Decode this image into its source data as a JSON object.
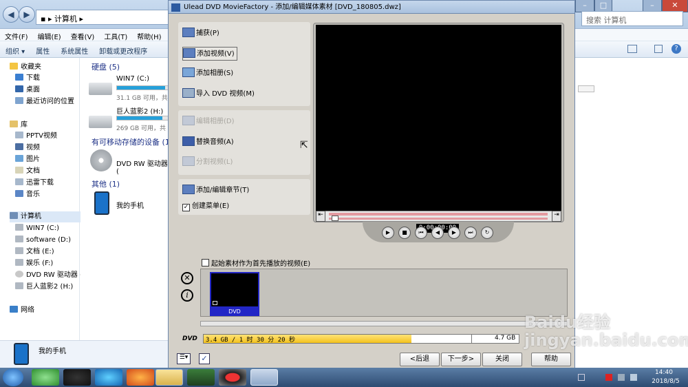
{
  "explorer": {
    "breadcrumb": "计算机",
    "search_placeholder": "搜索 计算机",
    "menu": [
      "文件(F)",
      "编辑(E)",
      "查看(V)",
      "工具(T)",
      "帮助(H)"
    ],
    "toolbar": [
      "组织 ▾",
      "属性",
      "系统属性",
      "卸载或更改程序"
    ],
    "sidebar": {
      "favorites": "收藏夹",
      "fav_items": [
        "下载",
        "桌面",
        "最近访问的位置"
      ],
      "libraries": "库",
      "lib_items": [
        "PPTV视频",
        "视频",
        "图片",
        "文档",
        "迅雷下载",
        "音乐"
      ],
      "computer": "计算机",
      "comp_items": [
        "WIN7 (C:)",
        "software (D:)",
        "文档 (E:)",
        "娱乐 (F:)",
        "DVD RW 驱动器 (G",
        "巨人蓝影2 (H:)"
      ],
      "network": "网络"
    },
    "main": {
      "hdd_header": "硬盘 (5)",
      "drives": [
        {
          "name": "WIN7 (C:)",
          "sub": "31.1 GB 可用，共",
          "fill": 0.9
        },
        {
          "name": "巨人蓝影2 (H:)",
          "sub": "269 GB 可用，共",
          "fill": 0.85
        }
      ],
      "removable_header": "有可移动存储的设备 (1",
      "dvd_name": "DVD RW 驱动器 (",
      "other_header": "其他 (1)",
      "phone_name": "我的手机"
    },
    "details_name": "我的手机"
  },
  "dialog": {
    "title": "Ulead DVD MovieFactory - 添加/编辑媒体素材    [DVD_180805.dwz]",
    "actions": {
      "capture": "捕获(P)",
      "add_video": "添加视频(V)",
      "add_album": "添加相册(S)",
      "import_dvd": "导入 DVD 视频(M)",
      "edit_album": "编辑相册(D)",
      "replace_audio": "替换音频(A)",
      "split_video": "分割视频(L)",
      "chapters": "添加/编辑章节(T)",
      "create_menu": "创建菜单(E)"
    },
    "timecode": "0:00:00:00",
    "first_play": "起始素材作为首先播放的视频(E)",
    "thumb_label": "DVD",
    "capacity": {
      "disc": "DVD",
      "used_text": "3.4 GB / 1 时 30 分 20 秒",
      "total": "4.7 GB",
      "used_fraction": 0.66
    },
    "buttons": {
      "back": "<后退",
      "next": "下一步>",
      "close": "关闭",
      "help": "帮助"
    }
  },
  "taskbar": {
    "time": "14:40",
    "date": "2018/8/5"
  },
  "watermark": "Baidu经验 jingyan.baidu.com"
}
